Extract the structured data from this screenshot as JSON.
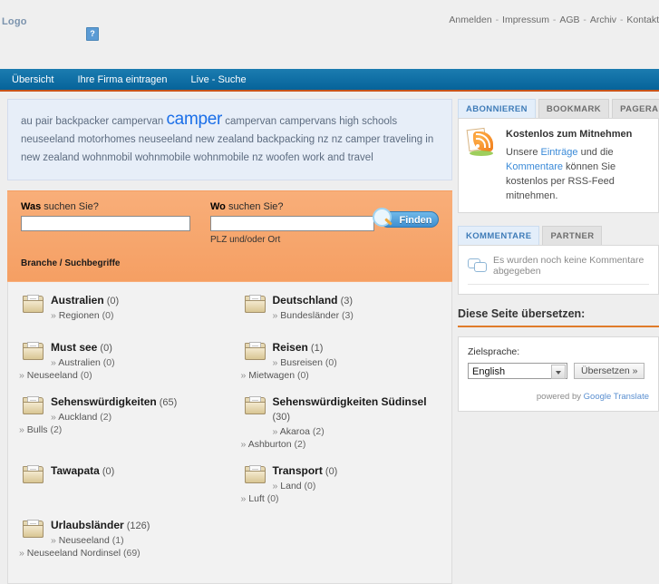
{
  "header": {
    "logo_text": "Logo",
    "broken_image_icon": "broken-image-icon",
    "broken_image_glyph": "?",
    "top_links": [
      "Anmelden",
      "Impressum",
      "AGB",
      "Archiv",
      "Kontakt"
    ],
    "separator": "-"
  },
  "nav": {
    "items": [
      {
        "label": "Übersicht"
      },
      {
        "label": "Ihre Firma eintragen"
      },
      {
        "label": "Live - Suche"
      }
    ]
  },
  "tagcloud": {
    "tags": [
      {
        "text": "au pair",
        "big": false
      },
      {
        "text": "backpacker",
        "big": false
      },
      {
        "text": "campervan",
        "big": false
      },
      {
        "text": "camper",
        "big": true
      },
      {
        "text": "campervan",
        "big": false
      },
      {
        "text": "campervans",
        "big": false
      },
      {
        "text": "high schools",
        "big": false
      },
      {
        "text": "neuseeland",
        "big": false
      },
      {
        "text": "motorhomes neuseeland",
        "big": false
      },
      {
        "text": "new zealand",
        "big": false
      },
      {
        "text": "backpacking nz",
        "big": false
      },
      {
        "text": "nz camper",
        "big": false
      },
      {
        "text": "traveling in new zealand",
        "big": false
      },
      {
        "text": "wohnmobil",
        "big": false
      },
      {
        "text": "wohnmobile",
        "big": false
      },
      {
        "text": "wohnmobile nz",
        "big": false
      },
      {
        "text": "woofen",
        "big": false
      },
      {
        "text": "work and travel",
        "big": false
      }
    ]
  },
  "search": {
    "what_label_bold": "Was",
    "what_label_rest": " suchen Sie?",
    "where_label_bold": "Wo",
    "where_label_rest": " suchen Sie?",
    "what_value": "",
    "where_value": "",
    "what_placeholder": "",
    "where_placeholder": "",
    "where_hint": "PLZ und/oder Ort",
    "branch_hint": "Branche / Suchbegriffe",
    "submit_label": "Finden",
    "submit_icon": "magnifier-icon"
  },
  "categories": [
    {
      "name": "Australien",
      "count": "(0)",
      "subs": [
        {
          "label": "Regionen",
          "count": "(0)",
          "outdent": false
        }
      ]
    },
    {
      "name": "Deutschland",
      "count": "(3)",
      "subs": [
        {
          "label": "Bundesländer",
          "count": "(3)",
          "outdent": false
        }
      ]
    },
    {
      "name": "Must see",
      "count": "(0)",
      "subs": [
        {
          "label": "Australien",
          "count": "(0)",
          "outdent": false
        },
        {
          "label": "Neuseeland",
          "count": "(0)",
          "outdent": true
        }
      ]
    },
    {
      "name": "Reisen",
      "count": "(1)",
      "subs": [
        {
          "label": "Busreisen",
          "count": "(0)",
          "outdent": false
        },
        {
          "label": "Mietwagen",
          "count": "(0)",
          "outdent": true
        }
      ]
    },
    {
      "name": "Sehenswürdigkeiten",
      "count": "(65)",
      "subs": [
        {
          "label": "Auckland",
          "count": "(2)",
          "outdent": false
        },
        {
          "label": "Bulls",
          "count": "(2)",
          "outdent": true
        }
      ]
    },
    {
      "name": "Sehenswürdigkeiten Südinsel",
      "count": "(30)",
      "subs": [
        {
          "label": "Akaroa",
          "count": "(2)",
          "outdent": false
        },
        {
          "label": "Ashburton",
          "count": "(2)",
          "outdent": true
        }
      ]
    },
    {
      "name": "Tawapata",
      "count": "(0)",
      "subs": []
    },
    {
      "name": "Transport",
      "count": "(0)",
      "subs": [
        {
          "label": "Land",
          "count": "(0)",
          "outdent": false
        },
        {
          "label": "Luft",
          "count": "(0)",
          "outdent": true
        }
      ]
    },
    {
      "name": "Urlaubsländer",
      "count": "(126)",
      "subs": [
        {
          "label": "Neuseeland",
          "count": "(1)",
          "outdent": false
        },
        {
          "label": "Neuseeland Nordinsel",
          "count": "(69)",
          "outdent": true
        }
      ]
    }
  ],
  "sidebar": {
    "subscribe_widget": {
      "tabs": [
        {
          "label": "ABONNIEREN",
          "active": true
        },
        {
          "label": "BOOKMARK",
          "active": false
        },
        {
          "label": "PAGERANK™",
          "active": false
        }
      ],
      "icon": "rss-feed-icon",
      "title": "Kostenlos zum Mitnehmen",
      "text_part1": "Unsere ",
      "link1": "Einträge",
      "text_part2": " und die ",
      "link2": "Kommentare",
      "text_part3": " können Sie kostenlos per RSS-Feed mitnehmen."
    },
    "comments_widget": {
      "tabs": [
        {
          "label": "KOMMENTARE",
          "active": true
        },
        {
          "label": "PARTNER",
          "active": false
        }
      ],
      "icon": "speech-bubble-icon",
      "empty_text": "Es wurden noch keine Kommentare abgegeben"
    },
    "translate_widget": {
      "title": "Diese Seite übersetzen:",
      "field_label": "Zielsprache:",
      "selected_language": "English",
      "options": [
        "English"
      ],
      "button_label": "Übersetzen »",
      "powered_prefix": "powered by ",
      "powered_link": "Google Translate"
    }
  },
  "colors": {
    "nav_blue": "#0e6ba0",
    "accent_orange": "#e07b2a",
    "search_orange": "#f7a870",
    "tag_highlight": "#1b6fe8",
    "tagcloud_bg": "#e7eef8"
  }
}
